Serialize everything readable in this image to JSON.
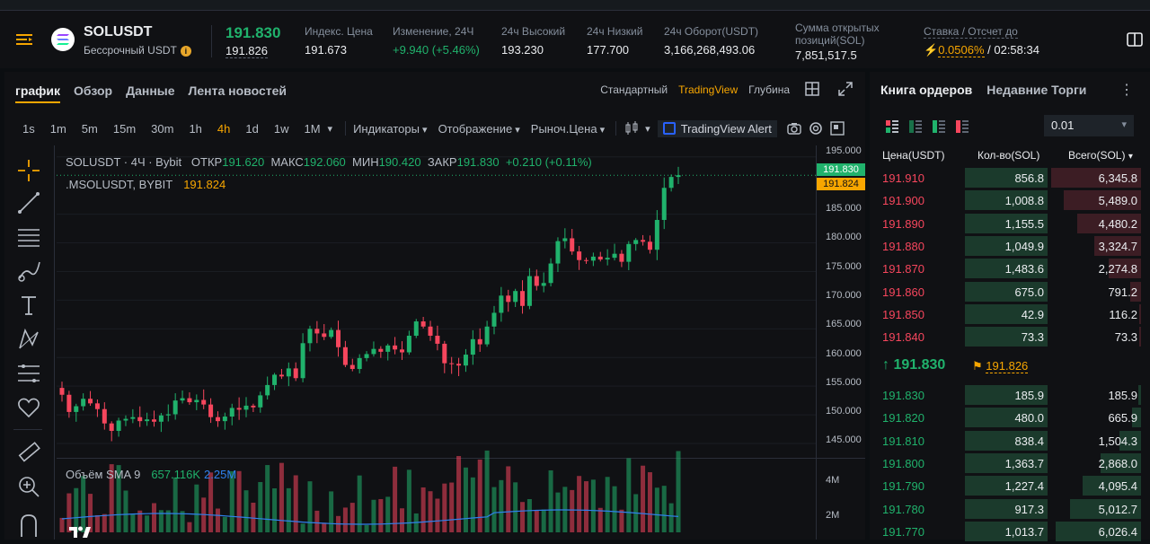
{
  "header": {
    "symbol": "SOLUSDT",
    "contract": "Бессрочный USDT",
    "last_price": "191.830",
    "mark_price": "191.826",
    "stats": [
      {
        "label": "Индекс. Цена",
        "value": "191.673"
      },
      {
        "label": "Изменение, 24Ч",
        "value": "+9.940 (+5.46%)"
      },
      {
        "label": "24ч Высокий",
        "value": "193.230"
      },
      {
        "label": "24ч Низкий",
        "value": "177.700"
      },
      {
        "label": "24ч Оборот(USDT)",
        "value": "3,166,268,493.06"
      }
    ],
    "open_interest_label_1": "Сумма открытых",
    "open_interest_label_2": "позиций(SOL)",
    "open_interest_value": "7,851,517.5",
    "funding_label": "Ставка / Отсчет до",
    "funding_rate": "0.0506%",
    "funding_sep": " / ",
    "funding_countdown": "02:58:34"
  },
  "chart_panel": {
    "tabs": [
      "график",
      "Обзор",
      "Данные",
      "Лента новостей"
    ],
    "view_modes": [
      "Стандартный",
      "TradingView",
      "Глубина"
    ],
    "timeframes": [
      "1s",
      "1m",
      "5m",
      "15m",
      "30m",
      "1h",
      "4h",
      "1d",
      "1w",
      "1M"
    ],
    "active_timeframe": "4h",
    "dropdowns": [
      "Индикаторы",
      "Отображение",
      "Рыноч.Цена"
    ],
    "alert_label": "TradingView Alert",
    "legend": {
      "symbol": "SOLUSDT · 4Ч · Bybit",
      "open_label": "ОТКР",
      "open": "191.620",
      "high_label": "МАКС",
      "high": "192.060",
      "low_label": "МИН",
      "low": "190.420",
      "close_label": "ЗАКР",
      "close": "191.830",
      "change": "+0.210 (+0.11%)",
      "mark_symbol": ".MSOLUSDT, BYBIT",
      "mark_value": "191.824"
    },
    "volume_legend": {
      "label": "Объём SMA 9",
      "v1": "657.116K",
      "v2": "2.25M"
    },
    "price_axis": [
      "195.000",
      "185.000",
      "180.000",
      "175.000",
      "170.000",
      "165.000",
      "160.000",
      "155.000",
      "150.000",
      "145.000"
    ],
    "price_tag_last": "191.830",
    "price_tag_mark": "191.824",
    "volume_axis": [
      "4M",
      "2M"
    ],
    "colors": {
      "up": "#20b26c",
      "down": "#f6465d",
      "accent": "#f7a600"
    }
  },
  "chart_data": {
    "type": "candlestick",
    "ylim": [
      142.5,
      197.0
    ],
    "closes": [
      153.5,
      150.5,
      151.5,
      152.8,
      152.0,
      151.0,
      148.5,
      147.2,
      149.0,
      149.3,
      149.6,
      148.9,
      149.2,
      148.8,
      149.9,
      150.1,
      152.5,
      152.9,
      152.2,
      152.6,
      151.8,
      149.6,
      148.9,
      149.7,
      151.2,
      150.9,
      151.6,
      151.3,
      153.4,
      155.2,
      157.0,
      156.7,
      158.1,
      156.4,
      162.5,
      165.0,
      164.2,
      163.6,
      164.8,
      161.8,
      158.7,
      158.0,
      159.9,
      160.6,
      161.5,
      161.0,
      162.1,
      161.4,
      160.9,
      163.8,
      166.3,
      165.4,
      163.8,
      162.4,
      159.0,
      158.9,
      158.6,
      160.5,
      163.2,
      162.3,
      165.4,
      167.8,
      170.8,
      169.7,
      171.6,
      169.0,
      174.2,
      172.5,
      173.0,
      176.4,
      180.3,
      180.8,
      178.5,
      177.0,
      176.9,
      177.6,
      177.1,
      177.4,
      178.1,
      176.7,
      179.8,
      180.5,
      180.2,
      178.8,
      184.0,
      189.6,
      191.5,
      191.8
    ],
    "volume_axis": [
      "4M",
      "2M"
    ]
  },
  "order_book": {
    "tabs": [
      "Книга ордеров",
      "Недавние Торги"
    ],
    "step": "0.01",
    "headers": {
      "price": "Цена(USDT)",
      "qty": "Кол-во(SOL)",
      "total": "Всего(SOL)"
    },
    "asks": [
      {
        "price": "191.910",
        "qty": "856.8",
        "total": "6,345.8"
      },
      {
        "price": "191.900",
        "qty": "1,008.8",
        "total": "5,489.0"
      },
      {
        "price": "191.890",
        "qty": "1,155.5",
        "total": "4,480.2"
      },
      {
        "price": "191.880",
        "qty": "1,049.9",
        "total": "3,324.7"
      },
      {
        "price": "191.870",
        "qty": "1,483.6",
        "total": "2,274.8"
      },
      {
        "price": "191.860",
        "qty": "675.0",
        "total": "791.2"
      },
      {
        "price": "191.850",
        "qty": "42.9",
        "total": "116.2"
      },
      {
        "price": "191.840",
        "qty": "73.3",
        "total": "73.3"
      }
    ],
    "mid_price": "↑ 191.830",
    "mid_mark": "191.826",
    "bids": [
      {
        "price": "191.830",
        "qty": "185.9",
        "total": "185.9"
      },
      {
        "price": "191.820",
        "qty": "480.0",
        "total": "665.9"
      },
      {
        "price": "191.810",
        "qty": "838.4",
        "total": "1,504.3"
      },
      {
        "price": "191.800",
        "qty": "1,363.7",
        "total": "2,868.0"
      },
      {
        "price": "191.790",
        "qty": "1,227.4",
        "total": "4,095.4"
      },
      {
        "price": "191.780",
        "qty": "917.3",
        "total": "5,012.7"
      },
      {
        "price": "191.770",
        "qty": "1,013.7",
        "total": "6,026.4"
      }
    ]
  }
}
